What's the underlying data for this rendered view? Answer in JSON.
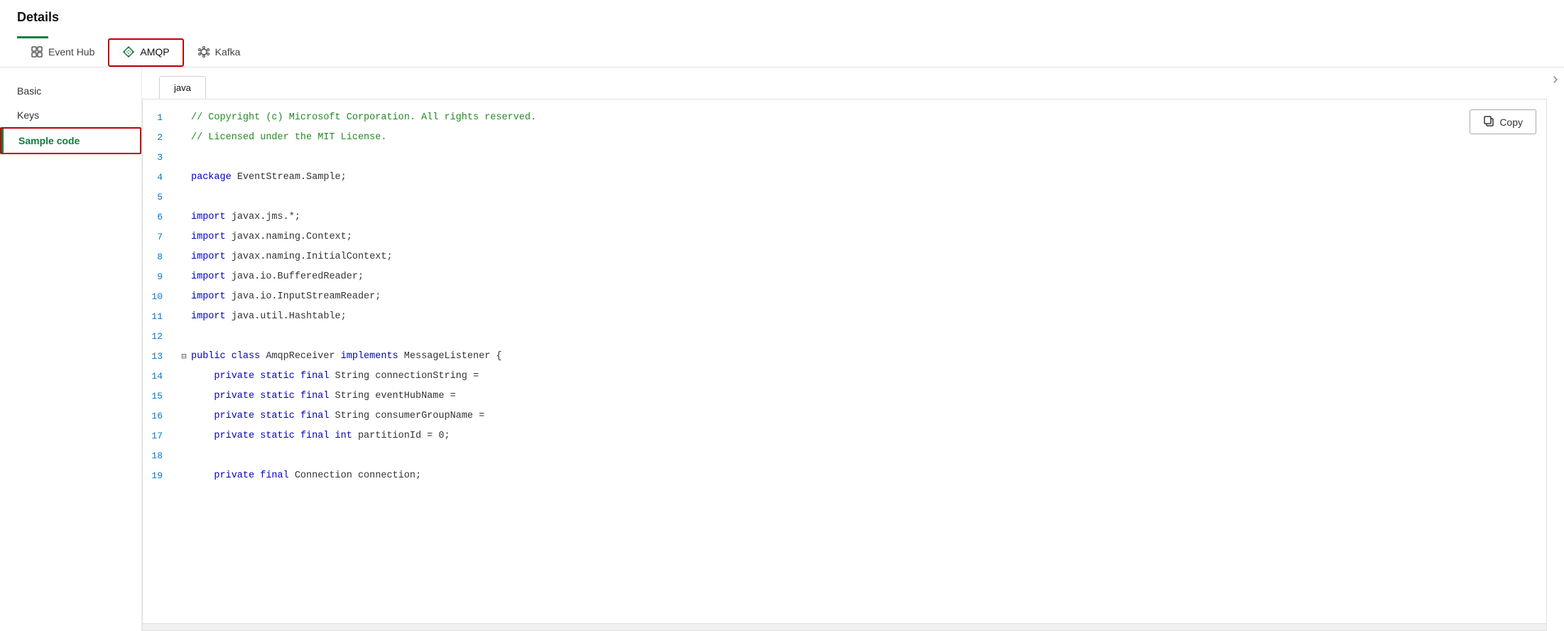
{
  "header": {
    "title": "Details",
    "underline_color": "#107c41"
  },
  "tabs": [
    {
      "id": "event-hub",
      "label": "Event Hub",
      "icon": "grid-icon",
      "active": false
    },
    {
      "id": "amqp",
      "label": "AMQP",
      "icon": "diamond-icon",
      "active": true
    },
    {
      "id": "kafka",
      "label": "Kafka",
      "icon": "hexagon-icon",
      "active": false
    }
  ],
  "sidebar": {
    "items": [
      {
        "id": "basic",
        "label": "Basic",
        "active": false
      },
      {
        "id": "keys",
        "label": "Keys",
        "active": false
      },
      {
        "id": "sample-code",
        "label": "Sample code",
        "active": true
      }
    ]
  },
  "lang_tabs": [
    {
      "id": "java",
      "label": "java",
      "active": true
    }
  ],
  "copy_button": {
    "label": "Copy",
    "icon": "copy-icon"
  },
  "code": {
    "lines": [
      {
        "num": 1,
        "indent": 0,
        "collapsible": false,
        "parts": [
          {
            "type": "comment",
            "text": "// Copyright (c) Microsoft Corporation. All rights reserved."
          }
        ]
      },
      {
        "num": 2,
        "indent": 0,
        "collapsible": false,
        "parts": [
          {
            "type": "comment",
            "text": "// Licensed under the MIT License."
          }
        ]
      },
      {
        "num": 3,
        "indent": 0,
        "collapsible": false,
        "parts": [
          {
            "type": "normal",
            "text": ""
          }
        ]
      },
      {
        "num": 4,
        "indent": 0,
        "collapsible": false,
        "parts": [
          {
            "type": "keyword",
            "text": "package "
          },
          {
            "type": "normal",
            "text": "EventStream.Sample;"
          }
        ]
      },
      {
        "num": 5,
        "indent": 0,
        "collapsible": false,
        "parts": [
          {
            "type": "normal",
            "text": ""
          }
        ]
      },
      {
        "num": 6,
        "indent": 0,
        "collapsible": false,
        "parts": [
          {
            "type": "keyword",
            "text": "import "
          },
          {
            "type": "normal",
            "text": "javax.jms.*;"
          }
        ]
      },
      {
        "num": 7,
        "indent": 0,
        "collapsible": false,
        "parts": [
          {
            "type": "keyword",
            "text": "import "
          },
          {
            "type": "normal",
            "text": "javax.naming.Context;"
          }
        ]
      },
      {
        "num": 8,
        "indent": 0,
        "collapsible": false,
        "parts": [
          {
            "type": "keyword",
            "text": "import "
          },
          {
            "type": "normal",
            "text": "javax.naming.InitialContext;"
          }
        ]
      },
      {
        "num": 9,
        "indent": 0,
        "collapsible": false,
        "parts": [
          {
            "type": "keyword",
            "text": "import "
          },
          {
            "type": "normal",
            "text": "java.io.BufferedReader;"
          }
        ]
      },
      {
        "num": 10,
        "indent": 0,
        "collapsible": false,
        "parts": [
          {
            "type": "keyword",
            "text": "import "
          },
          {
            "type": "normal",
            "text": "java.io.InputStreamReader;"
          }
        ]
      },
      {
        "num": 11,
        "indent": 0,
        "collapsible": false,
        "parts": [
          {
            "type": "keyword",
            "text": "import "
          },
          {
            "type": "normal",
            "text": "java.util.Hashtable;"
          }
        ]
      },
      {
        "num": 12,
        "indent": 0,
        "collapsible": false,
        "parts": [
          {
            "type": "normal",
            "text": ""
          }
        ]
      },
      {
        "num": 13,
        "indent": 0,
        "collapsible": true,
        "collapse_char": "▬",
        "parts": [
          {
            "type": "keyword",
            "text": "public "
          },
          {
            "type": "keyword",
            "text": "class "
          },
          {
            "type": "normal",
            "text": "AmqpReceiver "
          },
          {
            "type": "keyword",
            "text": "implements "
          },
          {
            "type": "normal",
            "text": "MessageListener {"
          }
        ]
      },
      {
        "num": 14,
        "indent": 1,
        "collapsible": false,
        "parts": [
          {
            "type": "keyword",
            "text": "private "
          },
          {
            "type": "keyword",
            "text": "static "
          },
          {
            "type": "keyword",
            "text": "final "
          },
          {
            "type": "normal",
            "text": "String connectionString ="
          }
        ]
      },
      {
        "num": 15,
        "indent": 1,
        "collapsible": false,
        "parts": [
          {
            "type": "keyword",
            "text": "private "
          },
          {
            "type": "keyword",
            "text": "static "
          },
          {
            "type": "keyword",
            "text": "final "
          },
          {
            "type": "normal",
            "text": "String eventHubName ="
          }
        ]
      },
      {
        "num": 16,
        "indent": 1,
        "collapsible": false,
        "parts": [
          {
            "type": "keyword",
            "text": "private "
          },
          {
            "type": "keyword",
            "text": "static "
          },
          {
            "type": "keyword",
            "text": "final "
          },
          {
            "type": "normal",
            "text": "String consumerGroupName ="
          }
        ]
      },
      {
        "num": 17,
        "indent": 1,
        "collapsible": false,
        "parts": [
          {
            "type": "keyword",
            "text": "private "
          },
          {
            "type": "keyword",
            "text": "static "
          },
          {
            "type": "keyword",
            "text": "final "
          },
          {
            "type": "keyword",
            "text": "int "
          },
          {
            "type": "normal",
            "text": "partitionId = 0;"
          }
        ]
      },
      {
        "num": 18,
        "indent": 0,
        "collapsible": false,
        "parts": [
          {
            "type": "normal",
            "text": ""
          }
        ]
      },
      {
        "num": 19,
        "indent": 1,
        "collapsible": false,
        "parts": [
          {
            "type": "keyword",
            "text": "private "
          },
          {
            "type": "keyword",
            "text": "final "
          },
          {
            "type": "normal",
            "text": "Connection connection;"
          }
        ]
      }
    ]
  }
}
